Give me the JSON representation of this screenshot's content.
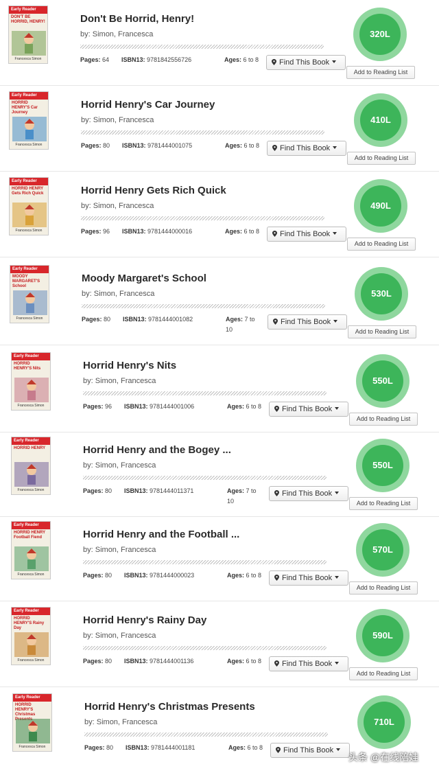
{
  "labels": {
    "by_prefix": "by:",
    "pages": "Pages:",
    "isbn": "ISBN13:",
    "ages": "Ages:",
    "find_button": "Find This Book",
    "add_button": "Add to Reading List"
  },
  "books": [
    {
      "title": "Don't Be Horrid, Henry!",
      "author": "Simon, Francesca",
      "pages": "64",
      "isbn": "9781842556726",
      "ages": "6 to 8",
      "lexile": "320L",
      "cover_title": "DON'T BE HORRID, HENRY!"
    },
    {
      "title": "Horrid Henry's Car Journey",
      "author": "Simon, Francesca",
      "pages": "80",
      "isbn": "9781444001075",
      "ages": "6 to 8",
      "lexile": "410L",
      "cover_title": "HORRID HENRY'S Car Journey"
    },
    {
      "title": "Horrid Henry Gets Rich Quick",
      "author": "Simon, Francesca",
      "pages": "96",
      "isbn": "9781444000016",
      "ages": "6 to 8",
      "lexile": "490L",
      "cover_title": "HORRID HENRY Gets Rich Quick"
    },
    {
      "title": "Moody Margaret's School",
      "author": "Simon, Francesca",
      "pages": "80",
      "isbn": "9781444001082",
      "ages": "7 to 10",
      "lexile": "530L",
      "cover_title": "MOODY MARGARET'S School"
    },
    {
      "title": "Horrid Henry's Nits",
      "author": "Simon, Francesca",
      "pages": "96",
      "isbn": "9781444001006",
      "ages": "6 to 8",
      "lexile": "550L",
      "cover_title": "HORRID HENRY'S Nits"
    },
    {
      "title": "Horrid Henry and the Bogey ...",
      "author": "Simon, Francesca",
      "pages": "80",
      "isbn": "9781444011371",
      "ages": "7 to 10",
      "lexile": "550L",
      "cover_title": "HORRID HENRY"
    },
    {
      "title": "Horrid Henry and the Football ...",
      "author": "Simon, Francesca",
      "pages": "80",
      "isbn": "9781444000023",
      "ages": "6 to 8",
      "lexile": "570L",
      "cover_title": "HORRID HENRY Football Fiend"
    },
    {
      "title": "Horrid Henry's Rainy Day",
      "author": "Simon, Francesca",
      "pages": "80",
      "isbn": "9781444001136",
      "ages": "6 to 8",
      "lexile": "590L",
      "cover_title": "HORRID HENRY'S Rainy Day"
    },
    {
      "title": "Horrid Henry's Christmas Presents",
      "author": "Simon, Francesca",
      "pages": "80",
      "isbn": "9781444001181",
      "ages": "6 to 8",
      "lexile": "710L",
      "cover_title": "HORRID HENRY'S Christmas Presents"
    }
  ],
  "cover_series_label": "Early Reader",
  "cover_author": "Francesca Simon",
  "watermark": "头条 @在线陪娃",
  "colors": {
    "lexile_outer": "#8fd79e",
    "lexile_inner": "#3db55a",
    "cover_band": "#d8262b"
  }
}
